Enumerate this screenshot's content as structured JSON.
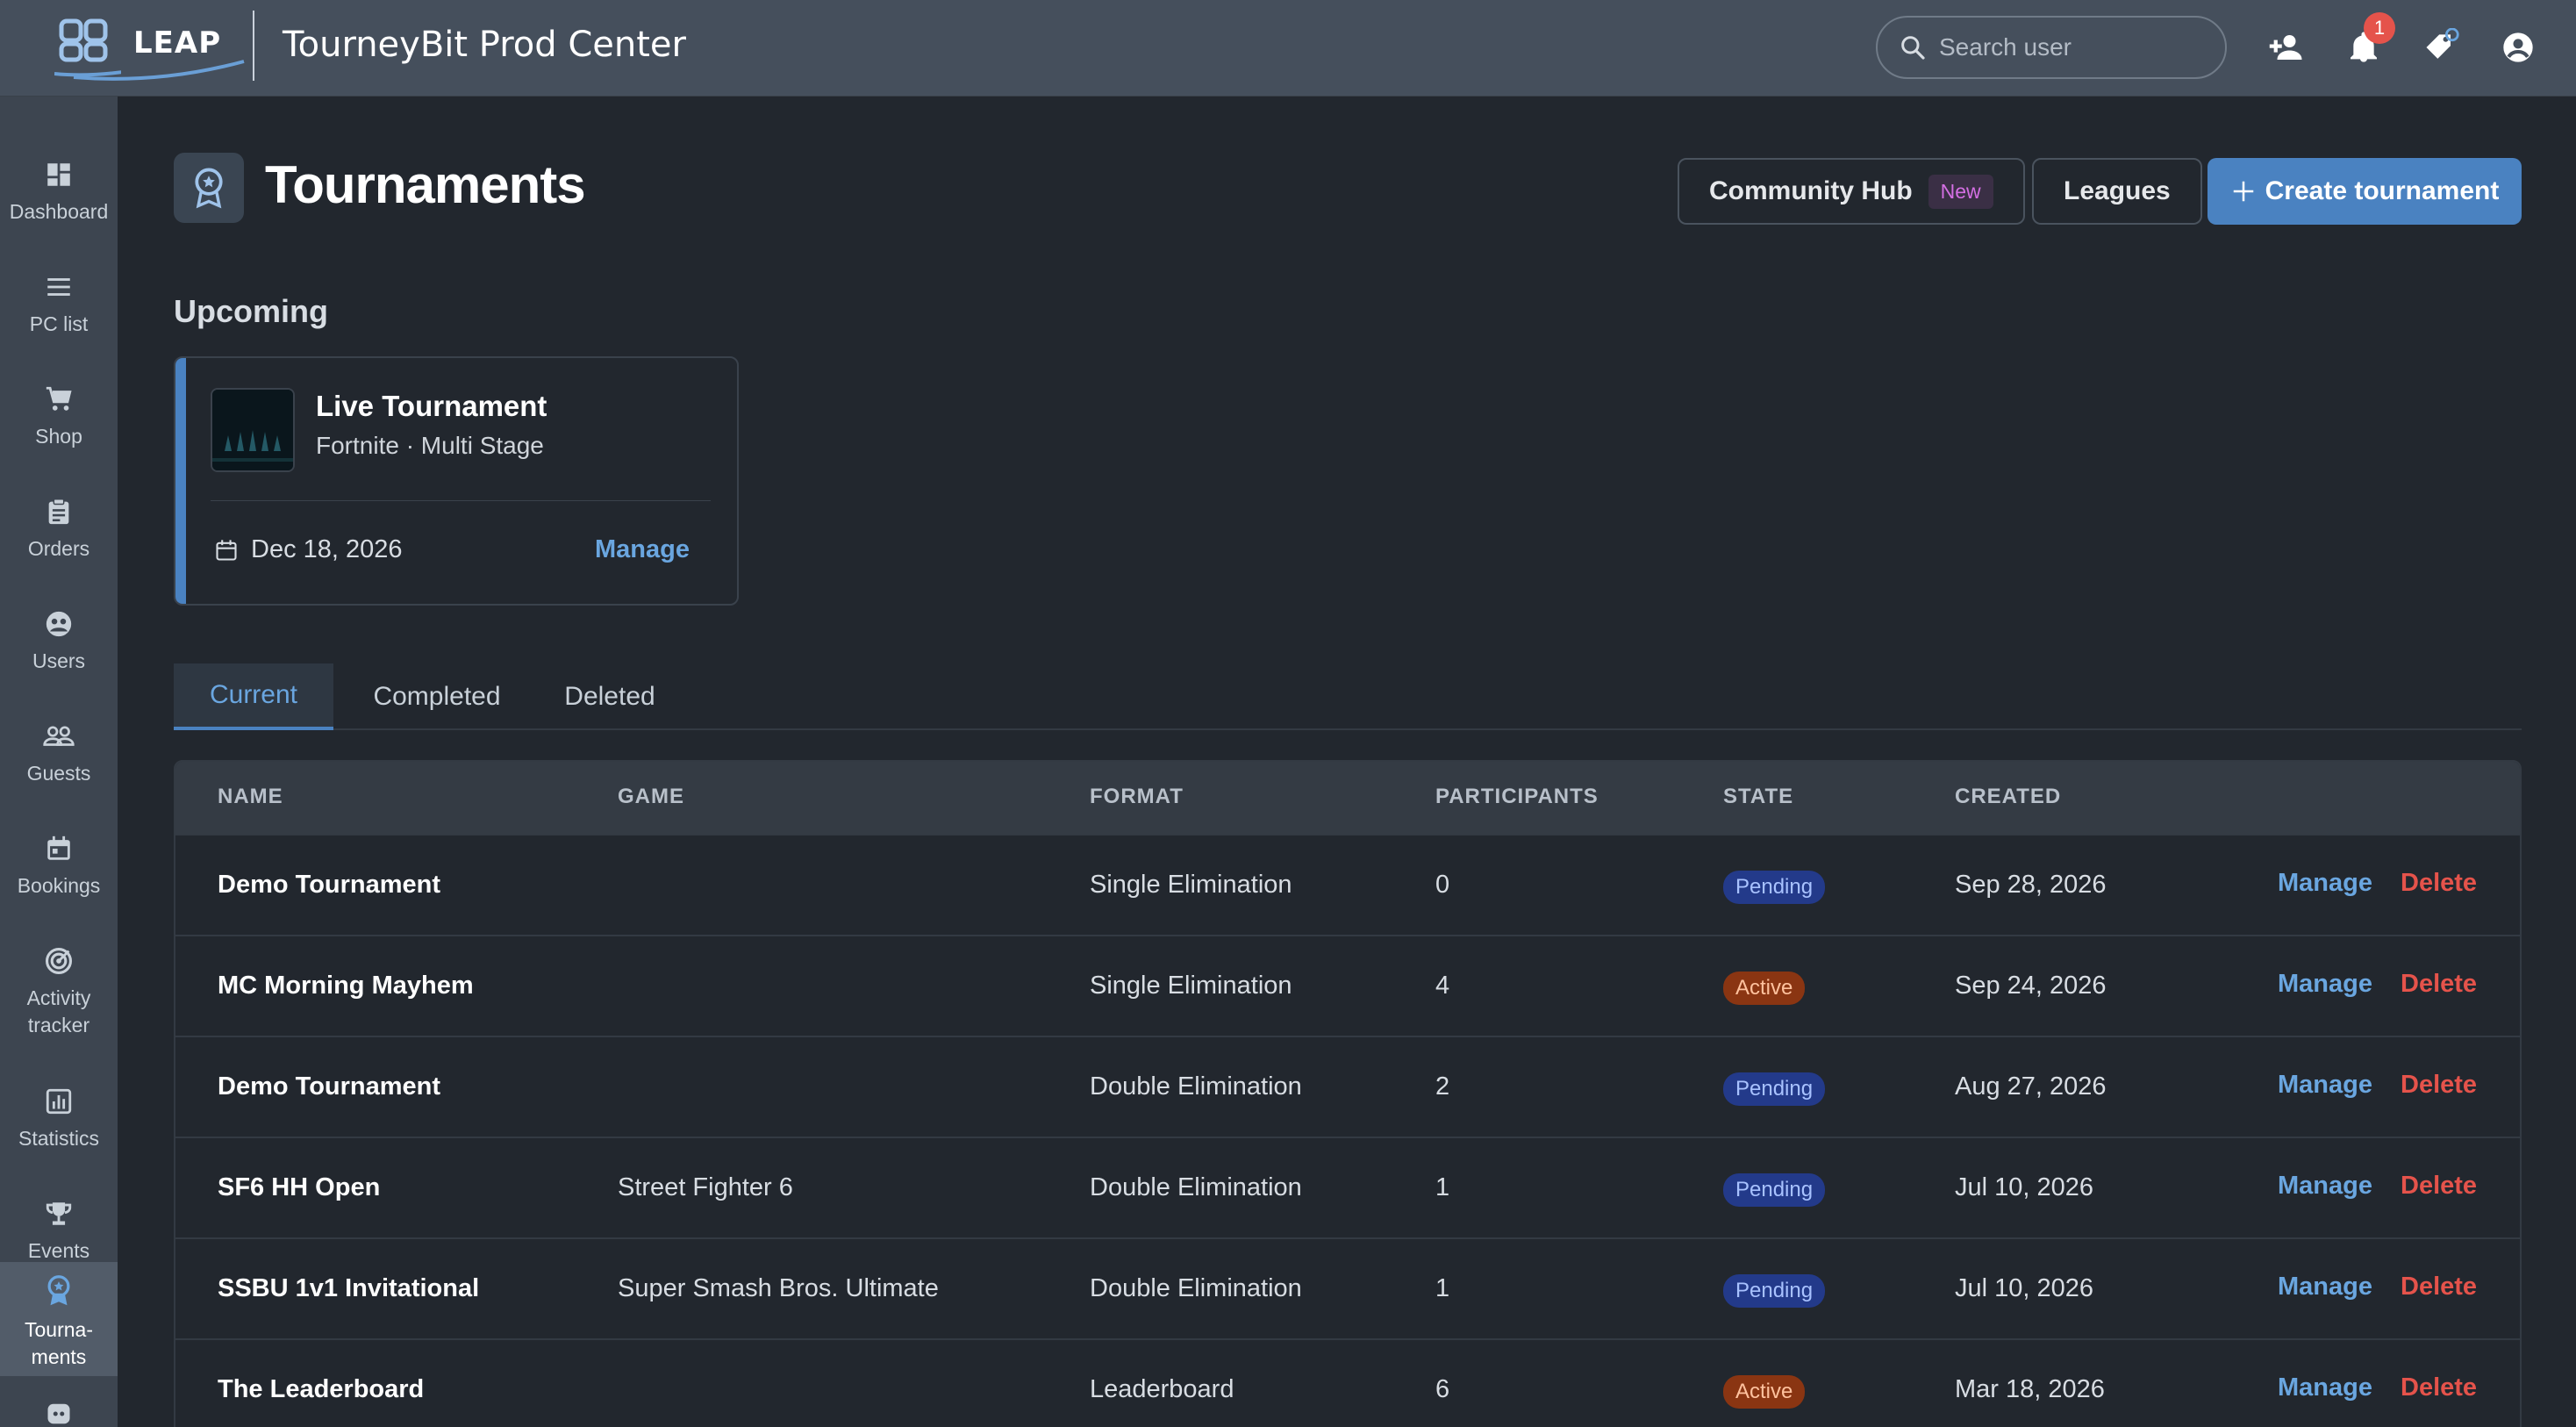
{
  "header": {
    "logo_text": "LEAP",
    "app_title": "TourneyBit Prod Center",
    "search_placeholder": "Search user",
    "notification_count": "1"
  },
  "sidebar": {
    "items": [
      {
        "label": "Dashboard",
        "icon": "dashboard-icon"
      },
      {
        "label": "PC list",
        "icon": "list-icon"
      },
      {
        "label": "Shop",
        "icon": "cart-icon"
      },
      {
        "label": "Orders",
        "icon": "clipboard-icon"
      },
      {
        "label": "Users",
        "icon": "users-icon"
      },
      {
        "label": "Guests",
        "icon": "guests-icon"
      },
      {
        "label": "Bookings",
        "icon": "calendar-icon"
      },
      {
        "label": "Activity tracker",
        "icon": "target-icon"
      },
      {
        "label": "Statistics",
        "icon": "chart-icon"
      },
      {
        "label": "Events",
        "icon": "trophy-icon"
      },
      {
        "label": "Tourna-ments",
        "icon": "award-icon"
      }
    ]
  },
  "page": {
    "title": "Tournaments",
    "community_hub_label": "Community Hub",
    "new_badge": "New",
    "leagues_label": "Leagues",
    "create_label": "Create tournament"
  },
  "upcoming": {
    "section_title": "Upcoming",
    "card": {
      "title": "Live Tournament",
      "subtitle": "Fortnite · Multi Stage",
      "date": "Dec 18, 2026",
      "manage_label": "Manage"
    }
  },
  "tabs": [
    "Current",
    "Completed",
    "Deleted"
  ],
  "table": {
    "headers": [
      "NAME",
      "GAME",
      "FORMAT",
      "PARTICIPANTS",
      "STATE",
      "CREATED"
    ],
    "rows": [
      {
        "name": "Demo Tournament",
        "game": "",
        "format": "Single Elimination",
        "participants": "0",
        "state": "Pending",
        "created": "Sep 28, 2026",
        "manage": "Manage",
        "delete": "Delete"
      },
      {
        "name": "MC Morning Mayhem",
        "game": "",
        "format": "Single Elimination",
        "participants": "4",
        "state": "Active",
        "created": "Sep 24, 2026",
        "manage": "Manage",
        "delete": "Delete"
      },
      {
        "name": "Demo Tournament",
        "game": "",
        "format": "Double Elimination",
        "participants": "2",
        "state": "Pending",
        "created": "Aug 27, 2026",
        "manage": "Manage",
        "delete": "Delete"
      },
      {
        "name": "SF6 HH Open",
        "game": "Street Fighter 6",
        "format": "Double Elimination",
        "participants": "1",
        "state": "Pending",
        "created": "Jul 10, 2026",
        "manage": "Manage",
        "delete": "Delete"
      },
      {
        "name": "SSBU 1v1 Invitational",
        "game": "Super Smash Bros. Ultimate",
        "format": "Double Elimination",
        "participants": "1",
        "state": "Pending",
        "created": "Jul 10, 2026",
        "manage": "Manage",
        "delete": "Delete"
      },
      {
        "name": "The Leaderboard",
        "game": "",
        "format": "Leaderboard",
        "participants": "6",
        "state": "Active",
        "created": "Mar 18, 2026",
        "manage": "Manage",
        "delete": "Delete"
      }
    ]
  },
  "colors": {
    "accent": "#4a82c1",
    "link": "#6aa6e0",
    "danger": "#e5534b",
    "pending_bg": "#233a8a",
    "active_bg": "#8a3512"
  }
}
